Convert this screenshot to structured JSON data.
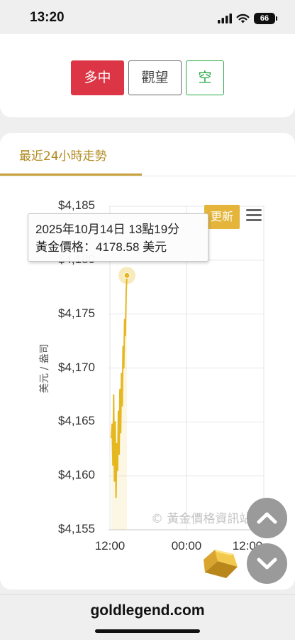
{
  "status_bar": {
    "time": "13:20",
    "battery": "66",
    "icons": [
      "cellular-signal-icon",
      "wifi-icon",
      "battery-icon"
    ]
  },
  "sentiment": {
    "buttons": [
      {
        "label": "多中",
        "color": "#dc3545"
      },
      {
        "label": "觀望",
        "color": "#444444"
      },
      {
        "label": "空",
        "color": "#28a745"
      }
    ]
  },
  "chart_section": {
    "tab_title": "最近24小時走勢",
    "update_label": "更新",
    "watermark": "© 黃金價格資訊站",
    "tooltip": {
      "date_line": "2025年10月14日 13點19分",
      "price_line": "黃金價格：4178.58 美元"
    }
  },
  "chart_data": {
    "type": "line",
    "ylabel": "美元 / 盎司",
    "xlabel": "",
    "y_ticks": [
      "$4,185",
      "$4,180",
      "$4,175",
      "$4,170",
      "$4,165",
      "$4,160",
      "$4,155"
    ],
    "x_ticks": [
      "12:00",
      "00:00",
      "12:00"
    ],
    "ylim": [
      4155,
      4185
    ],
    "grid": true,
    "series": [
      {
        "color": "#e6b820",
        "points": [
          [
            0.0,
            4163.5
          ],
          [
            0.02,
            4164.8
          ],
          [
            0.04,
            4161.0
          ],
          [
            0.06,
            4167.5
          ],
          [
            0.08,
            4159.5
          ],
          [
            0.1,
            4165.0
          ],
          [
            0.12,
            4158.0
          ],
          [
            0.14,
            4163.0
          ],
          [
            0.16,
            4160.5
          ],
          [
            0.18,
            4166.0
          ],
          [
            0.2,
            4162.0
          ],
          [
            0.22,
            4168.0
          ],
          [
            0.24,
            4164.0
          ],
          [
            0.26,
            4169.5
          ],
          [
            0.28,
            4166.5
          ],
          [
            0.3,
            4172.0
          ],
          [
            0.32,
            4170.0
          ],
          [
            0.34,
            4174.5
          ],
          [
            0.36,
            4173.0
          ],
          [
            0.38,
            4177.0
          ],
          [
            0.4,
            4178.58
          ]
        ]
      }
    ],
    "highlight_point": {
      "x": 0.4,
      "y": 4178.58
    }
  },
  "footer": {
    "site": "goldlegend.com"
  },
  "icons": {
    "scroll_up": "chevron-up-icon",
    "scroll_down": "chevron-down-icon",
    "menu": "hamburger-menu-icon",
    "gold": "gold-bar-icon"
  }
}
